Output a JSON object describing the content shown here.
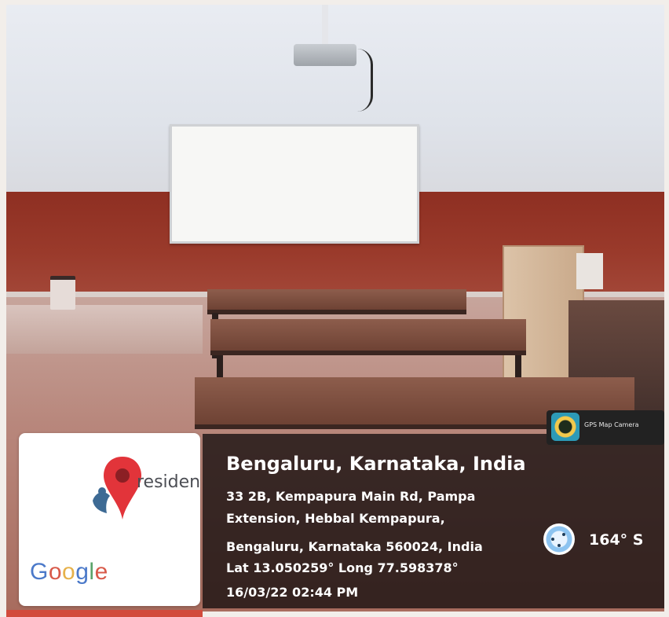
{
  "logo": {
    "brand_text": "residen",
    "google_letters": [
      "G",
      "o",
      "o",
      "g",
      "l",
      "e"
    ],
    "pin_color": "#e2343a",
    "people_color": "#3d6a94"
  },
  "gps_overlay": {
    "app_name": "GPS Map Camera",
    "location_title": "Bengaluru, Karnataka, India",
    "address_line_1": "33 2B, Kempapura Main Rd, Pampa",
    "address_line_2": "Extension, Hebbal Kempapura,",
    "address_line_3": "Bengaluru, Karnataka 560024, India",
    "coordinates": "Lat 13.050259° Long 77.598378°",
    "timestamp": "16/03/22 02:44 PM",
    "heading": "164° S"
  },
  "colors": {
    "wall_red": "#9a3a2b",
    "panel_bg": "#140e0e",
    "accent_stripe": "#d24b3c"
  }
}
